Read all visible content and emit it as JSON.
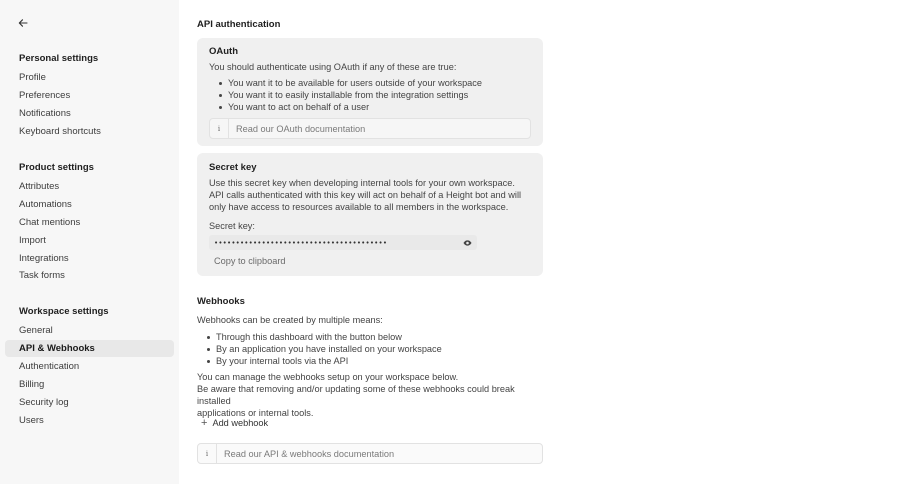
{
  "sidebar": {
    "back_icon": "arrow-left-icon",
    "sections": [
      {
        "heading": "Personal settings",
        "items": [
          "Profile",
          "Preferences",
          "Notifications",
          "Keyboard shortcuts"
        ]
      },
      {
        "heading": "Product settings",
        "items": [
          "Attributes",
          "Automations",
          "Chat mentions",
          "Import",
          "Integrations",
          "Task forms"
        ]
      },
      {
        "heading": "Workspace settings",
        "items": [
          "General",
          "API & Webhooks",
          "Authentication",
          "Billing",
          "Security log",
          "Users"
        ]
      }
    ],
    "active_item": "API & Webhooks"
  },
  "api_auth": {
    "title": "API authentication",
    "oauth": {
      "title": "OAuth",
      "intro": "You should authenticate using OAuth if any of these are true:",
      "bullets": [
        "You want it to be available for users outside of your workspace",
        "You want it to easily installable from the integration settings",
        "You want to act on behalf of a user"
      ],
      "doc_link": "Read our OAuth documentation"
    },
    "secret_key": {
      "title": "Secret key",
      "description_lines": [
        "Use this secret key when developing internal tools for your own workspace.",
        "API calls authenticated with this key will act on behalf of a Height bot and will",
        "only have access to resources available to all members in the workspace."
      ],
      "field_label": "Secret key:",
      "masked_value": "••••••••••••••••••••••••••••••••••••••••",
      "copy_label": "Copy to clipboard"
    }
  },
  "webhooks": {
    "title": "Webhooks",
    "intro": "Webhooks can be created by multiple means:",
    "bullets": [
      "Through this dashboard with the button below",
      "By an application you have installed on your workspace",
      "By your internal tools via the API"
    ],
    "note_lines": [
      "You can manage the webhooks setup on your workspace below.",
      "Be aware that removing and/or updating some of these webhooks could break installed",
      "applications or internal tools."
    ],
    "add_label": "Add webhook",
    "doc_link": "Read our API & webhooks documentation"
  },
  "colors": {
    "sidebar_bg": "#f7f7f7",
    "card_bg": "#f0f0f0",
    "active_item_bg": "#e8e8e8"
  }
}
